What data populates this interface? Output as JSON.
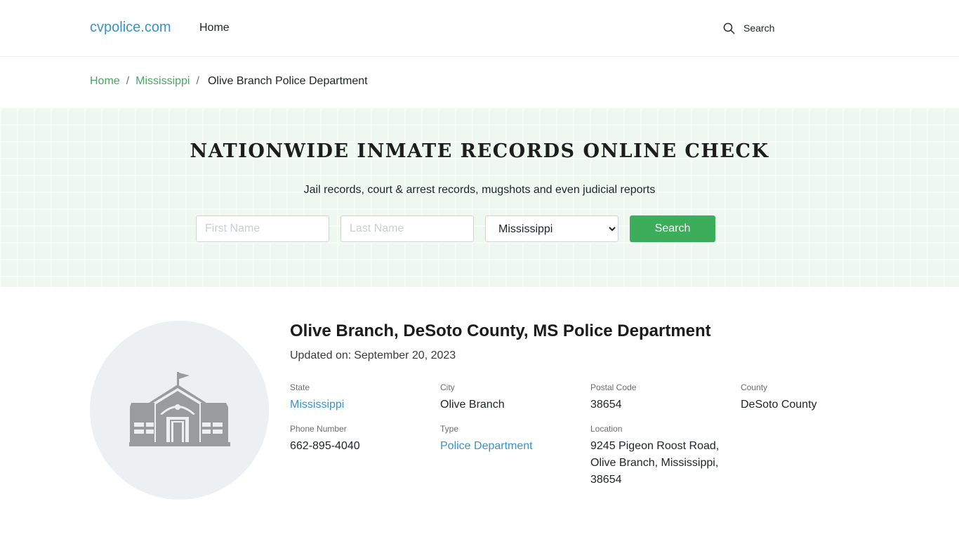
{
  "header": {
    "brand": "cvpolice.com",
    "nav_home": "Home",
    "search_label": "Search",
    "search_icon": "magnifier"
  },
  "breadcrumb": {
    "items": [
      "Home",
      "Mississippi"
    ],
    "current": "Olive Branch Police Department",
    "separator": "/"
  },
  "hero": {
    "heading": "NATIONWIDE INMATE RECORDS ONLINE CHECK",
    "subheading": "Jail records, court & arrest records, mugshots and even judicial reports",
    "first_name_placeholder": "First Name",
    "last_name_placeholder": "Last Name",
    "state_selected": "Mississippi",
    "search_button": "Search"
  },
  "department": {
    "icon": "building-icon",
    "title": "Olive Branch, DeSoto County, MS Police Department",
    "updated_label": "Updated on:",
    "updated_value": "September 20, 2023",
    "fields": {
      "state": {
        "label": "State",
        "value": "Mississippi"
      },
      "city": {
        "label": "City",
        "value": "Olive Branch"
      },
      "postal": {
        "label": "Postal Code",
        "value": "38654"
      },
      "county": {
        "label": "County",
        "value": "DeSoto County"
      },
      "phone": {
        "label": "Phone Number",
        "value": "662-895-4040"
      },
      "type": {
        "label": "Type",
        "value": "Police Department"
      },
      "location": {
        "label": "Location",
        "value": "9245 Pigeon Roost Road, Olive Branch, Mississippi, 38654"
      }
    }
  },
  "colors": {
    "brand": "#3a93c7",
    "breadcrumb_link": "#4aa564",
    "button": "#3cad5b",
    "hero_bg": "#eef8f1"
  }
}
